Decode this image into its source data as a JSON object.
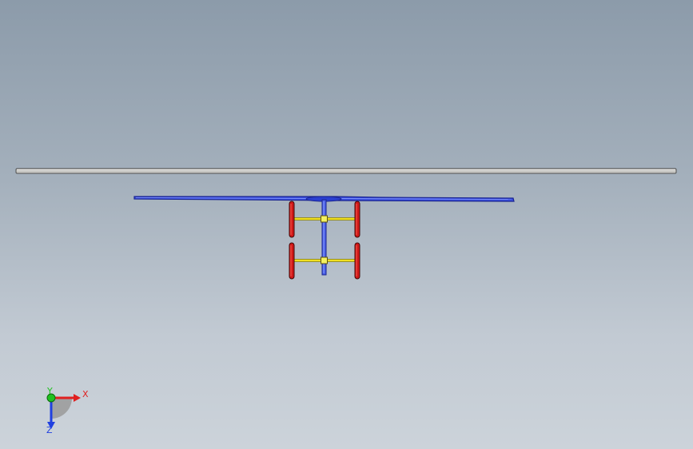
{
  "viewport": {
    "background_top": "#8c9baa",
    "background_bottom": "#ccd3da"
  },
  "triad": {
    "x_label": "X",
    "y_label": "Y",
    "z_label": "Z",
    "x_color": "#e02020",
    "y_color": "#20c020",
    "z_color": "#2040e0"
  },
  "model": {
    "rail_color": "#c8c8c4",
    "deck_color": "#2a3fd0",
    "axle_color": "#f0e020",
    "wheel_color": "#d01818",
    "hub_color": "#f4f060"
  }
}
